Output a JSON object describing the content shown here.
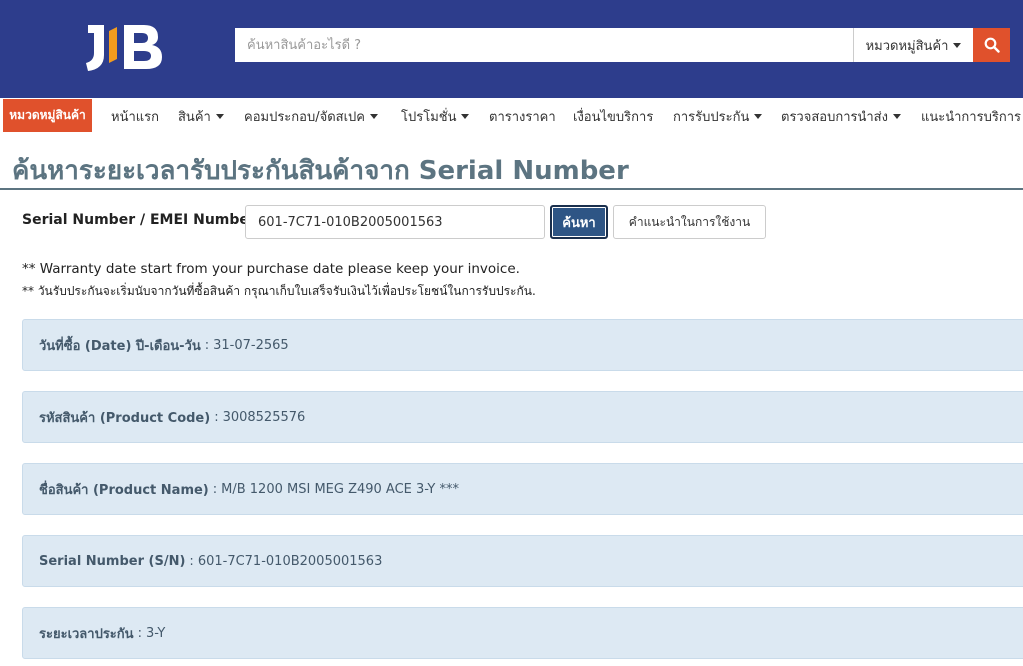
{
  "header": {
    "logo_text": "JIB",
    "search_placeholder": "ค้นหาสินค้าอะไรดี ?",
    "category_select": "หมวดหมู่สินค้า",
    "colors": {
      "header_bg": "#2d3d8c",
      "accent": "#e0512c"
    }
  },
  "nav": {
    "category_button": "หมวดหมู่สินค้า",
    "items": [
      {
        "label": "หน้าแรก",
        "dropdown": false
      },
      {
        "label": "สินค้า",
        "dropdown": true
      },
      {
        "label": "คอมประกอบ/จัดสเปค",
        "dropdown": true
      },
      {
        "label": "โปรโมชั่น",
        "dropdown": true
      },
      {
        "label": "ตารางราคา",
        "dropdown": false
      },
      {
        "label": "เงื่อนไขบริการ",
        "dropdown": false
      },
      {
        "label": "การรับประกัน",
        "dropdown": true
      },
      {
        "label": "ตรวจสอบการนำส่ง",
        "dropdown": true
      },
      {
        "label": "แนะนำการบริการ",
        "dropdown": false
      }
    ]
  },
  "page": {
    "title": "ค้นหาระยะเวลารับประกันสินค้าจาก Serial Number"
  },
  "form": {
    "label": "Serial Number / EMEI Number :",
    "value": "601-7C71-010B2005001563",
    "search_button": "ค้นหา",
    "guide_button": "คำแนะนำในการใช้งาน"
  },
  "notes": {
    "en": "** Warranty date start from your purchase date please keep your invoice.",
    "th": "** วันรับประกันจะเริ่มนับจากวันที่ซื้อสินค้า กรุณาเก็บใบเสร็จรับเงินไว้เพื่อประโยชน์ในการรับประกัน."
  },
  "results": [
    {
      "label": "วันที่ซื้อ (Date) ปี-เดือน-วัน",
      "value": "31-07-2565"
    },
    {
      "label": "รหัสสินค้า (Product Code)",
      "value": "3008525576"
    },
    {
      "label": "ชื่อสินค้า (Product Name)",
      "value": "M/B 1200 MSI MEG Z490 ACE 3-Y ***"
    },
    {
      "label": "Serial Number (S/N)",
      "value": "601-7C71-010B2005001563"
    },
    {
      "label": "ระยะเวลาประกัน",
      "value": "3-Y"
    }
  ]
}
